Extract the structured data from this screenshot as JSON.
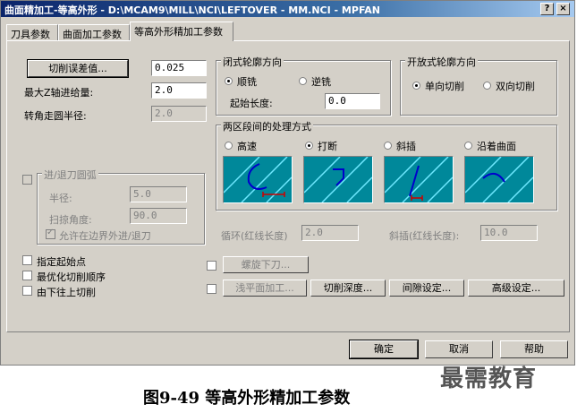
{
  "window": {
    "title": "曲面精加工-等高外形 - D:\\MCAM9\\MILL\\NCI\\LEFTOVER - MM.NCI - MPFAN",
    "help_btn": "?",
    "close_btn": "×"
  },
  "tabs": [
    {
      "label": "刀具参数"
    },
    {
      "label": "曲面加工参数"
    },
    {
      "label": "等高外形精加工参数"
    }
  ],
  "left": {
    "tolerance_button": "切削误差值...",
    "tolerance_value": "0.025",
    "max_z_step_label": "最大Z轴进给量:",
    "max_z_step_value": "2.0",
    "corner_radius_label": "转角走圆半径:",
    "corner_radius_value": "2.0"
  },
  "closed_contour": {
    "title": "闭式轮廓方向",
    "climb": "顺铣",
    "conventional": "逆铣",
    "start_length_label": "起始长度:",
    "start_length_value": "0.0"
  },
  "open_contour": {
    "title": "开放式轮廓方向",
    "one_way": "单向切削",
    "two_way": "双向切削"
  },
  "gap": {
    "title": "两区段间的处理方式",
    "options": [
      {
        "label": "高速"
      },
      {
        "label": "打断"
      },
      {
        "label": "斜插"
      },
      {
        "label": "沿着曲面"
      }
    ],
    "loop_label": "循环(红线长度)",
    "loop_value": "2.0",
    "ramp_label": "斜插(红线长度):",
    "ramp_value": "10.0"
  },
  "arc": {
    "title": "进/退刀圆弧",
    "radius_label": "半径:",
    "radius_value": "5.0",
    "sweep_label": "扫掠角度:",
    "sweep_value": "90.0",
    "allow_label": "允许在边界外进/退刀"
  },
  "checks": {
    "start_point": "指定起始点",
    "optimize": "最优化切削顺序",
    "bottom_up": "由下往上切削",
    "helix": "螺旋下刀...",
    "shallow": "浅平面加工...",
    "depth": "切削深度...",
    "gap_settings": "间隙设定...",
    "advanced": "高级设定..."
  },
  "footer": {
    "ok": "确定",
    "cancel": "取消",
    "help": "帮助"
  },
  "caption": "图9-49 等高外形精加工参数",
  "watermark": "最需教育",
  "colors": {
    "titlebar": "#0a246a",
    "dialog": "#d4d0c8",
    "preview_bg": "#00889a",
    "toolpath": "#0000cc",
    "lead_mark": "#cc0000"
  }
}
